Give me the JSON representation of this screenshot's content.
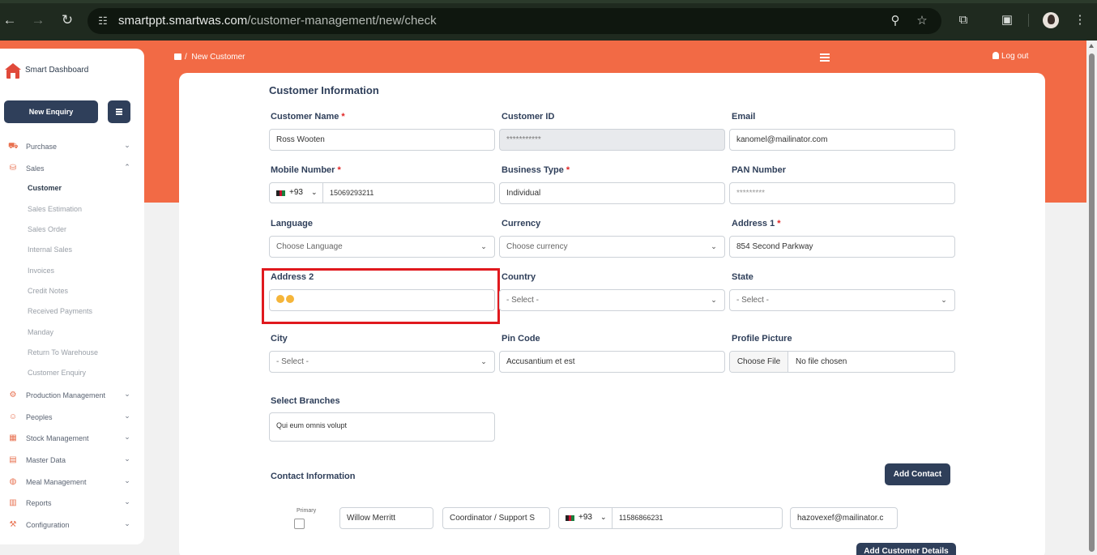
{
  "browser": {
    "url_domain": "smartppt.smartwas.com",
    "url_path": "/customer-management/new/check",
    "icons": [
      "back-icon",
      "forward-icon",
      "reload-icon",
      "tune-icon",
      "zoom-icon",
      "star-icon",
      "extensions-icon",
      "tab-search-icon",
      "avatar",
      "more-icon"
    ]
  },
  "header": {
    "breadcrumb_separator": "/",
    "breadcrumb_current": "New Customer",
    "logout_label": "Log out"
  },
  "sidebar": {
    "app_title": "Smart Dashboard",
    "new_enquiry_label": "New Enquiry",
    "items": [
      {
        "label": "Purchase",
        "chevron": "⌄"
      },
      {
        "label": "Sales",
        "chevron": "⌃"
      },
      {
        "label": "Production Management",
        "chevron": "⌄"
      },
      {
        "label": "Peoples",
        "chevron": "⌄"
      },
      {
        "label": "Stock Management",
        "chevron": "⌄"
      },
      {
        "label": "Master Data",
        "chevron": "⌄"
      },
      {
        "label": "Meal Management",
        "chevron": "⌄"
      },
      {
        "label": "Reports",
        "chevron": "⌄"
      },
      {
        "label": "Configuration",
        "chevron": "⌄"
      }
    ],
    "sales_subitems": [
      "Customer",
      "Sales Estimation",
      "Sales Order",
      "Internal Sales",
      "Invoices",
      "Credit Notes",
      "Received Payments",
      "Manday",
      "Return To Warehouse",
      "Customer Enquiry"
    ],
    "active_subitem": "Customer"
  },
  "form": {
    "section_title": "Customer Information",
    "customer_name": {
      "label": "Customer Name",
      "value": "Ross Wooten"
    },
    "customer_id": {
      "label": "Customer ID",
      "value": "***********"
    },
    "email": {
      "label": "Email",
      "value": "kanomel@mailinator.com"
    },
    "mobile": {
      "label": "Mobile Number",
      "code": "+93",
      "value": "15069293211"
    },
    "business_type": {
      "label": "Business Type",
      "value": "Individual"
    },
    "pan": {
      "label": "PAN Number",
      "value": "*********"
    },
    "language": {
      "label": "Language",
      "value": "Choose Language"
    },
    "currency": {
      "label": "Currency",
      "value": "Choose currency"
    },
    "address1": {
      "label": "Address 1",
      "value": "854 Second Parkway"
    },
    "address2": {
      "label": "Address 2",
      "value": ""
    },
    "country": {
      "label": "Country",
      "value": "- Select -"
    },
    "state": {
      "label": "State",
      "value": "- Select -"
    },
    "city": {
      "label": "City",
      "value": "- Select -"
    },
    "pin_code": {
      "label": "Pin Code",
      "value": "Accusantium et est"
    },
    "profile_picture": {
      "label": "Profile Picture",
      "button": "Choose File",
      "status": "No file chosen"
    },
    "branches": {
      "label": "Select Branches",
      "value": "Qui eum omnis volupt"
    },
    "required_mark": "*"
  },
  "contact": {
    "section_title": "Contact Information",
    "add_contact_label": "Add Contact",
    "primary_label": "Primary",
    "name": "Willow Merritt",
    "role": "Coordinator / Support S",
    "code": "+93",
    "phone": "11586866231",
    "email": "hazovexef@mailinator.c",
    "add_details_label": "Add Customer Details"
  },
  "colors": {
    "brand_orange": "#f26a45",
    "navy": "#2f3f5a",
    "highlight_red": "#e0191e"
  }
}
